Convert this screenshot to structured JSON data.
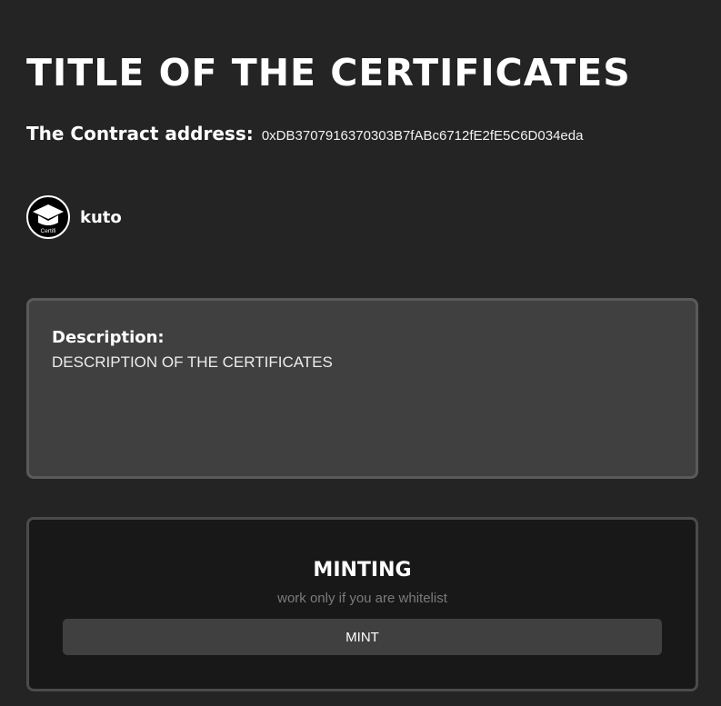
{
  "page": {
    "title": "TITLE OF THE CERTIFICATES",
    "contract_label": "The Contract address:",
    "contract_address": "0xDB3707916370303B7fABc6712fE2fE5C6D034eda"
  },
  "creator": {
    "avatar_text": "Certifi",
    "name": "kuto"
  },
  "description": {
    "label": "Description:",
    "text": "DESCRIPTION OF THE CERTIFICATES"
  },
  "minting": {
    "title": "MINTING",
    "subtitle": "work only if you are whitelist",
    "button_label": "MINT"
  },
  "colors": {
    "background": "#242424",
    "description_panel": "#404040",
    "minting_panel": "#181818",
    "button": "#404040"
  }
}
